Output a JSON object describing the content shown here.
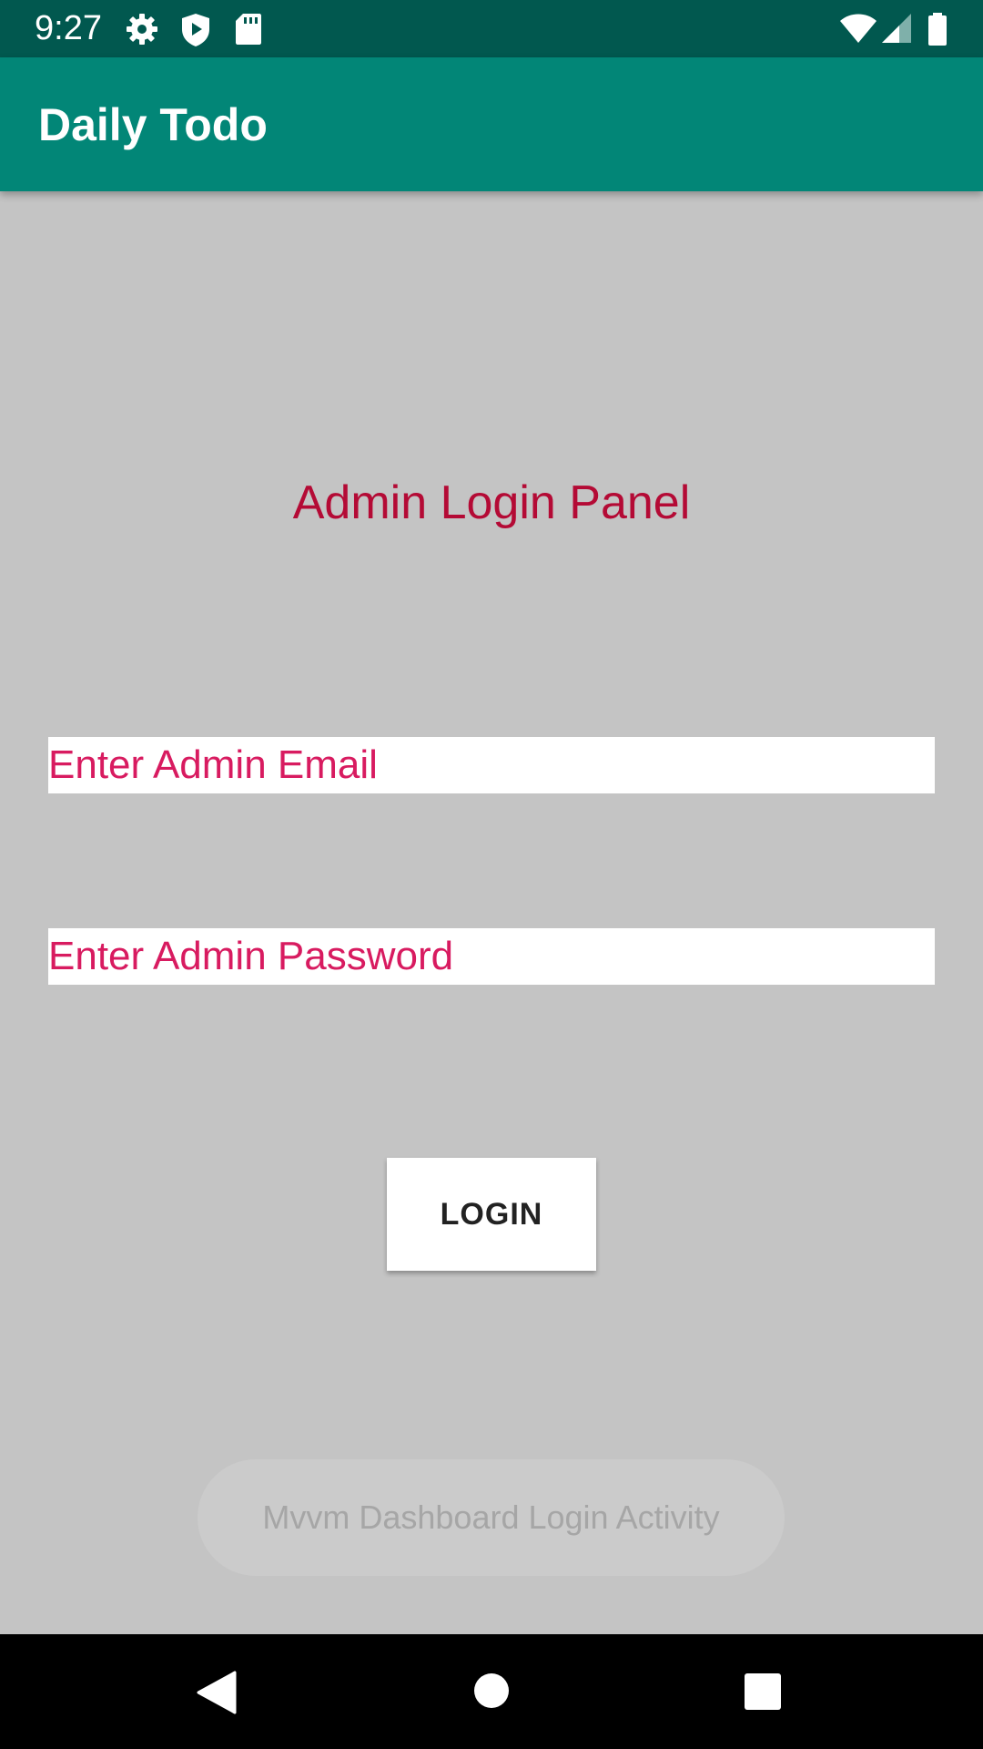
{
  "status_bar": {
    "time": "9:27",
    "left_icons": [
      "gear-icon",
      "shield-play-icon",
      "sd-card-icon"
    ],
    "right_icons": [
      "wifi-icon",
      "cell-signal-icon",
      "battery-icon"
    ]
  },
  "app_bar": {
    "title": "Daily Todo"
  },
  "login": {
    "heading": "Admin Login Panel",
    "email_placeholder": "Enter Admin Email",
    "password_placeholder": "Enter Admin Password",
    "button_label": "LOGIN"
  },
  "toast": {
    "message": "Mvvm Dashboard Login Activity"
  },
  "nav_bar": {
    "buttons": [
      "back-icon",
      "home-icon",
      "recents-icon"
    ]
  },
  "colors": {
    "status_bar": "#01584f",
    "app_bar": "#028677",
    "background": "#c4c4c4",
    "heading": "#b40a35",
    "input_hint": "#d81b60"
  }
}
